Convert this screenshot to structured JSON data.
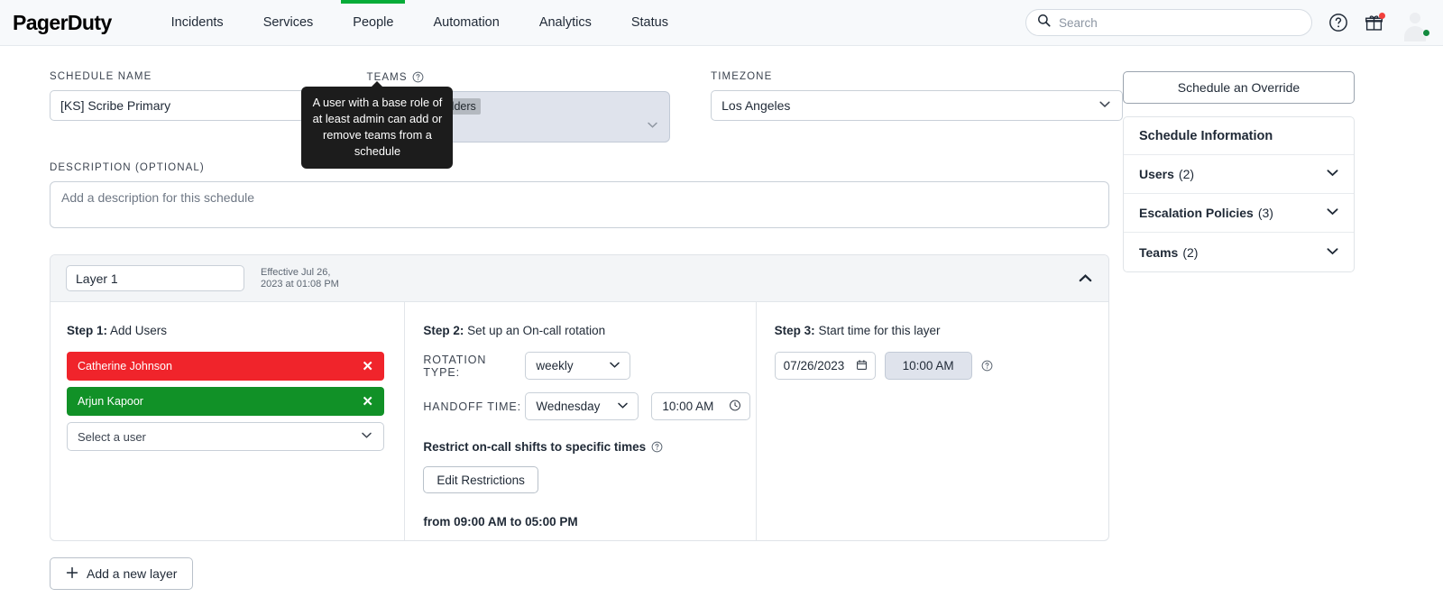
{
  "nav": {
    "logo": "PagerDuty",
    "items": [
      {
        "label": "Incidents",
        "active": false
      },
      {
        "label": "Services",
        "active": false
      },
      {
        "label": "People",
        "active": true
      },
      {
        "label": "Automation",
        "active": false
      },
      {
        "label": "Analytics",
        "active": false
      },
      {
        "label": "Status",
        "active": false
      }
    ],
    "search_placeholder": "Search",
    "icons": [
      "search-icon",
      "help-icon",
      "gift-icon",
      "avatar"
    ]
  },
  "form": {
    "schedule_name_label": "SCHEDULE NAME",
    "schedule_name_value": "[KS] Scribe Primary",
    "teams_label": "TEAMS",
    "teams_chip": "...tive Stakeholders",
    "teams_tooltip": "A user with a base role of at least admin can add or remove teams from a schedule",
    "timezone_label": "TIMEZONE",
    "timezone_value": "Los Angeles",
    "description_label": "DESCRIPTION (OPTIONAL)",
    "description_placeholder": "Add a description for this schedule",
    "description_value": ""
  },
  "layer": {
    "name_value": "Layer 1",
    "effective_line1": "Effective Jul 26,",
    "effective_line2": "2023 at 01:08 PM",
    "step1": {
      "title_bold": "Step 1:",
      "title_rest": " Add Users",
      "users": [
        {
          "name": "Catherine Johnson",
          "color": "#f0242b"
        },
        {
          "name": "Arjun Kapoor",
          "color": "#119127"
        }
      ],
      "select_placeholder": "Select a user"
    },
    "step2": {
      "title_bold": "Step 2:",
      "title_rest": " Set up an On-call rotation",
      "rotation_type_label": "ROTATION TYPE:",
      "rotation_type_value": "weekly",
      "handoff_label": "HANDOFF TIME:",
      "handoff_day": "Wednesday",
      "handoff_time": "10:00 AM",
      "restrict_label": "Restrict on-call shifts to specific times",
      "edit_restrictions_button": "Edit Restrictions",
      "from_to": "from 09:00 AM to 05:00 PM"
    },
    "step3": {
      "title_bold": "Step 3:",
      "title_rest": " Start time for this layer",
      "date_value": "07/26/2023",
      "time_value": "10:00 AM"
    },
    "add_layer_button": "Add a new layer"
  },
  "rail": {
    "override_button": "Schedule an Override",
    "panel_title": "Schedule Information",
    "rows": [
      {
        "label": "Users",
        "count": "(2)"
      },
      {
        "label": "Escalation Policies",
        "count": "(3)"
      },
      {
        "label": "Teams",
        "count": "(2)"
      }
    ]
  }
}
